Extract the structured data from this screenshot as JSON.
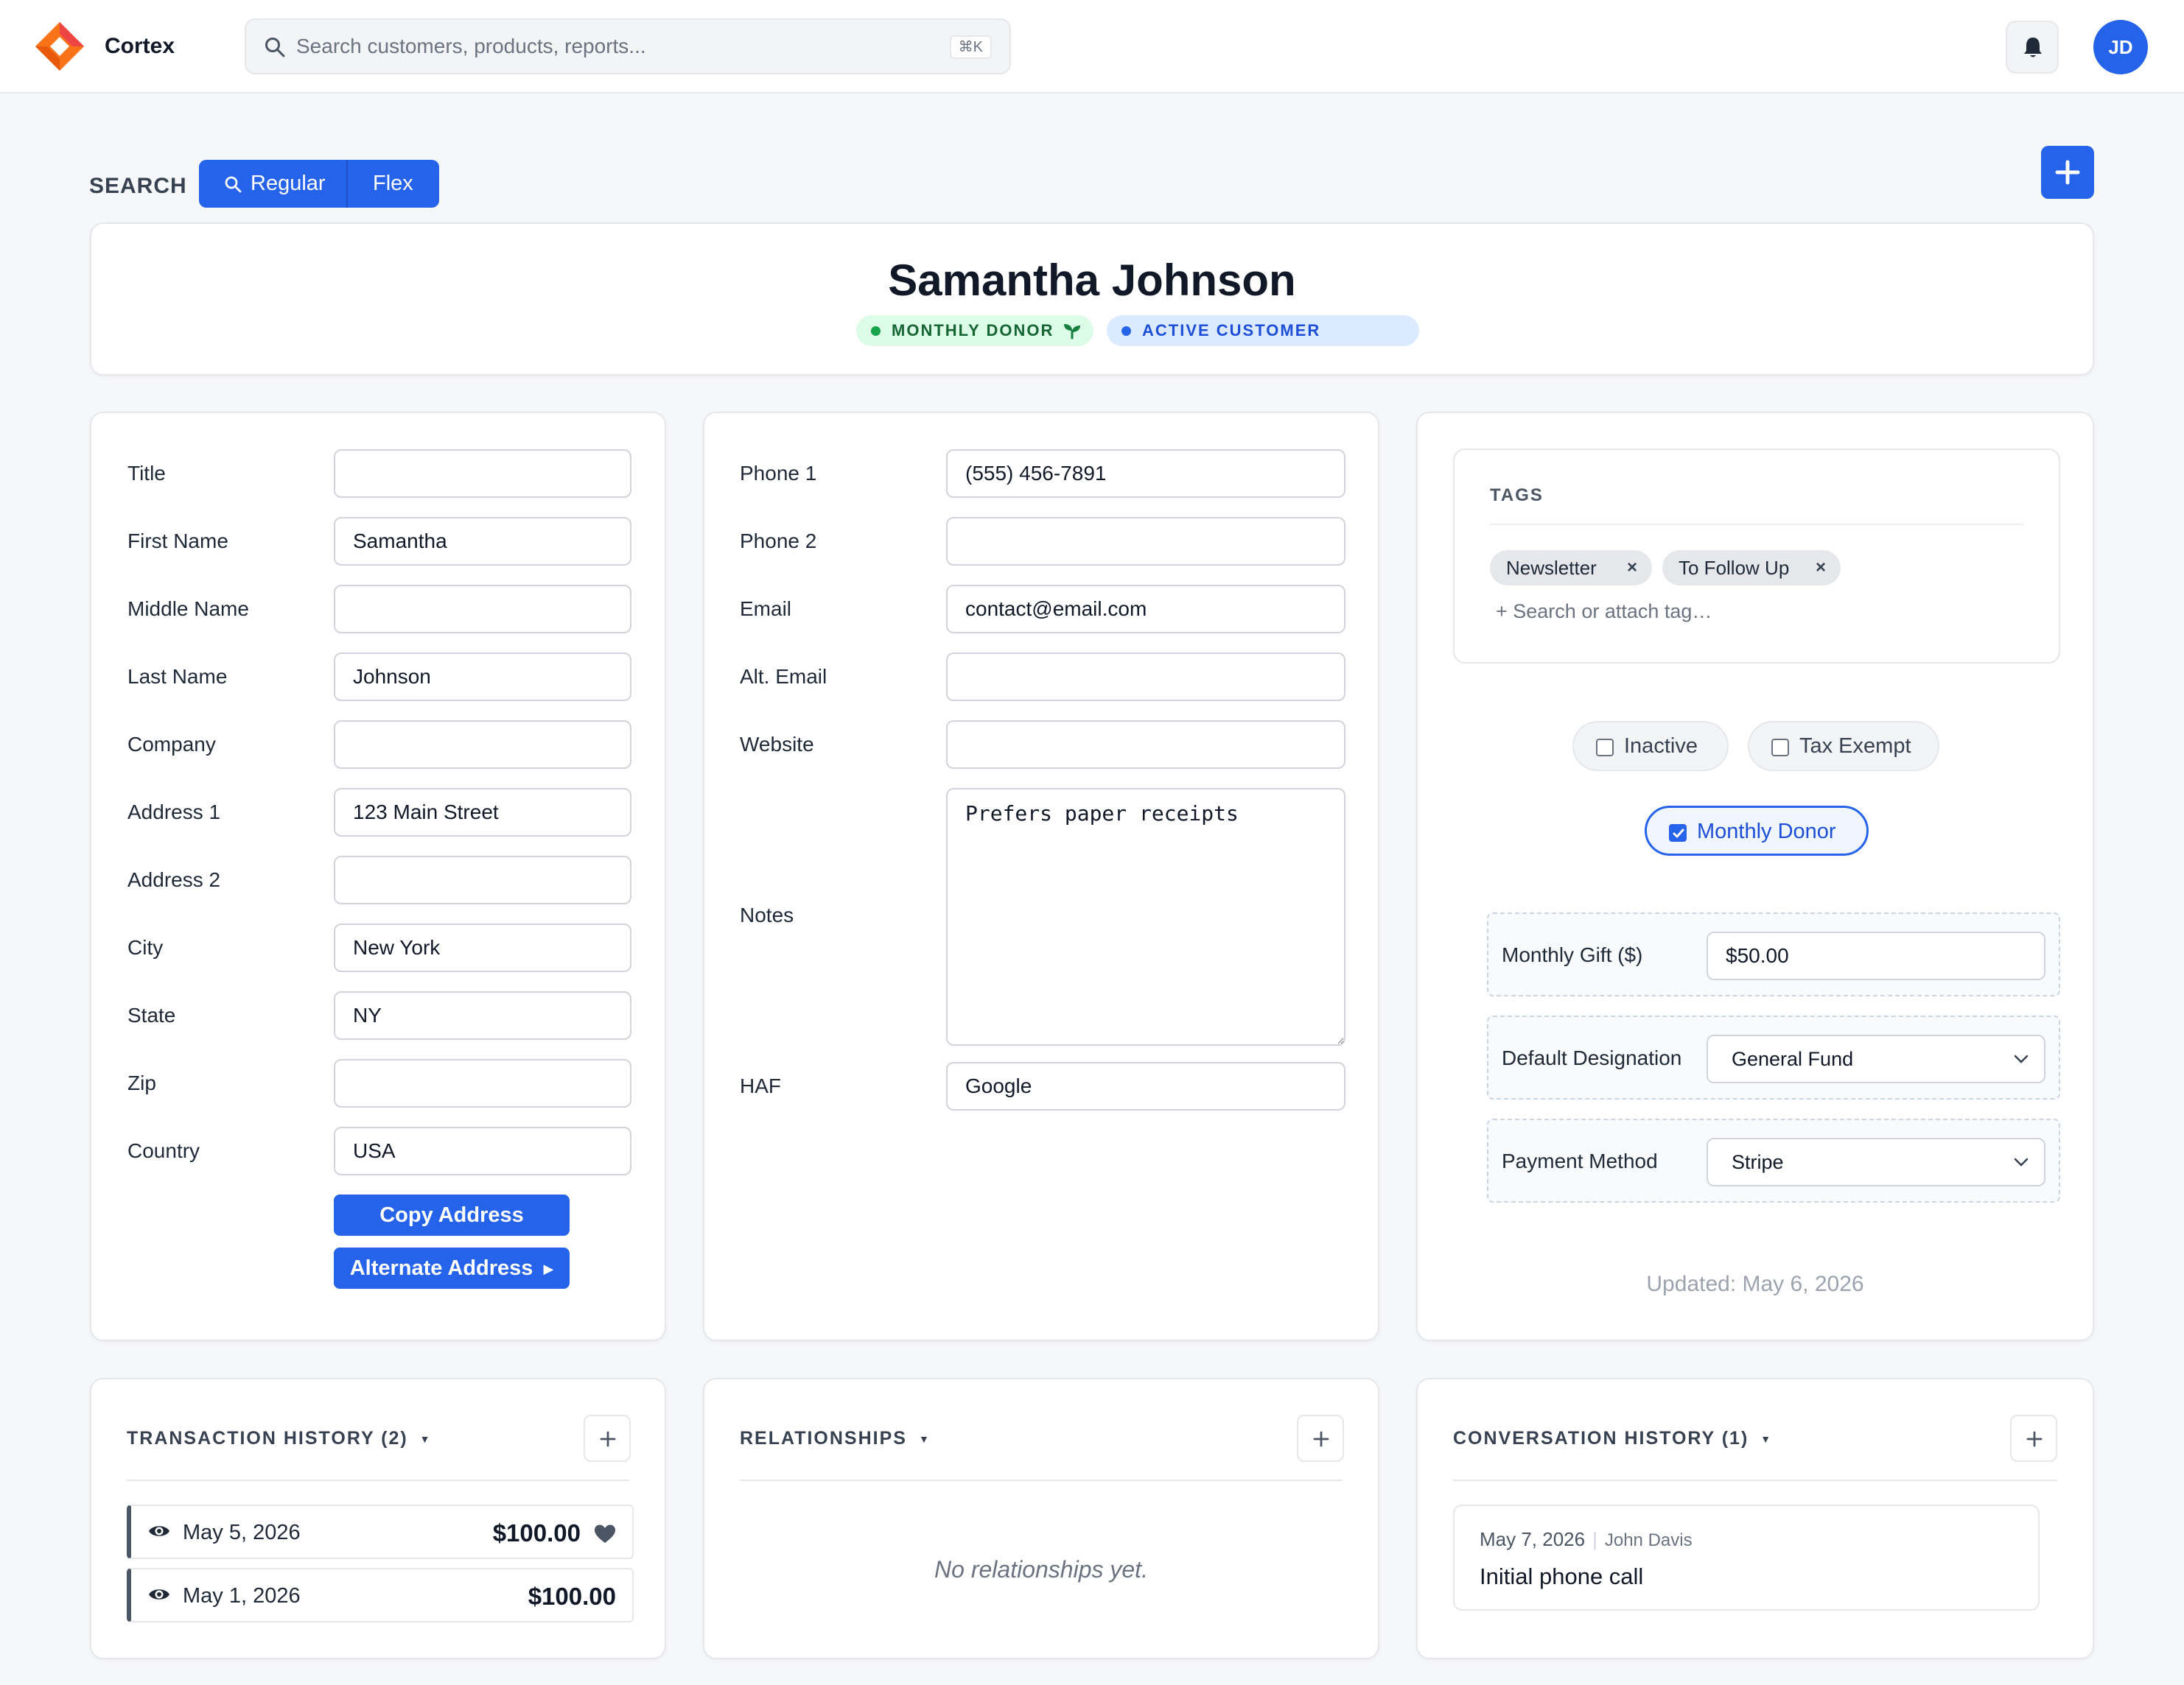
{
  "app": {
    "name": "Cortex"
  },
  "topbar": {
    "search_placeholder": "Search customers, products, reports...",
    "shortcut": "⌘K",
    "avatar_initials": "JD"
  },
  "search_mode": {
    "label": "SEARCH",
    "options": [
      "Regular",
      "Flex"
    ],
    "selected": "Regular"
  },
  "customer": {
    "name": "Samantha Johnson",
    "badges": [
      {
        "label": "MONTHLY DONOR",
        "color": "#16a34a"
      },
      {
        "label": "ACTIVE CUSTOMER",
        "color": "#2563eb"
      }
    ]
  },
  "contact_fields": [
    {
      "label": "Title",
      "value": ""
    },
    {
      "label": "First Name",
      "value": "Samantha"
    },
    {
      "label": "Middle Name",
      "value": ""
    },
    {
      "label": "Last Name",
      "value": "Johnson"
    },
    {
      "label": "Company",
      "value": ""
    },
    {
      "label": "Address 1",
      "value": "123 Main Street"
    },
    {
      "label": "Address 2",
      "value": ""
    },
    {
      "label": "City",
      "value": "New York"
    },
    {
      "label": "State",
      "value": "NY"
    },
    {
      "label": "Zip",
      "value": ""
    },
    {
      "label": "Country",
      "value": "USA"
    }
  ],
  "address_buttons": {
    "copy": "Copy Address",
    "alternate": "Alternate Address"
  },
  "communication_fields": [
    {
      "label": "Phone 1",
      "value": "(555) 456-7891"
    },
    {
      "label": "Phone 2",
      "value": ""
    },
    {
      "label": "Email",
      "value": "contact@email.com"
    },
    {
      "label": "Alt. Email",
      "value": ""
    },
    {
      "label": "Website",
      "value": ""
    }
  ],
  "notes": {
    "label": "Notes",
    "value": "Prefers paper receipts"
  },
  "haf": {
    "label": "HAF",
    "value": "Google"
  },
  "tags": {
    "title": "TAGS",
    "items": [
      "Newsletter",
      "To Follow Up"
    ],
    "add_placeholder": "+ Search or attach tag…"
  },
  "flags": {
    "inactive": {
      "label": "Inactive",
      "checked": false
    },
    "tax_exempt": {
      "label": "Tax Exempt",
      "checked": false
    },
    "monthly_donor": {
      "label": "Monthly Donor",
      "checked": true
    }
  },
  "donor": {
    "monthly_gift": {
      "label": "Monthly Gift ($)",
      "value": "$50.00"
    },
    "designation": {
      "label": "Default Designation",
      "value": "General Fund"
    },
    "payment_method": {
      "label": "Payment Method",
      "value": "Stripe"
    }
  },
  "updated": "Updated: May 6, 2026",
  "transactions": {
    "title": "TRANSACTION HISTORY (2)",
    "items": [
      {
        "date": "May 5, 2026",
        "amount": "$100.00"
      },
      {
        "date": "May 1, 2026",
        "amount": "$100.00"
      }
    ]
  },
  "relationships": {
    "title": "RELATIONSHIPS",
    "empty": "No relationships yet."
  },
  "conversations": {
    "title": "CONVERSATION HISTORY (1)",
    "items": [
      {
        "date": "May 7, 2026",
        "author": "John Davis",
        "subject": "Initial phone call"
      }
    ]
  },
  "colors": {
    "accent": "#2563eb",
    "donor_green": "#16a34a",
    "background": "#f6f7f9"
  },
  "icons": [
    "cortex-logo",
    "search-icon",
    "bell-icon",
    "plus-icon",
    "sprout-icon",
    "eye-icon",
    "heart-icon",
    "chevron-down-icon",
    "close-icon"
  ]
}
